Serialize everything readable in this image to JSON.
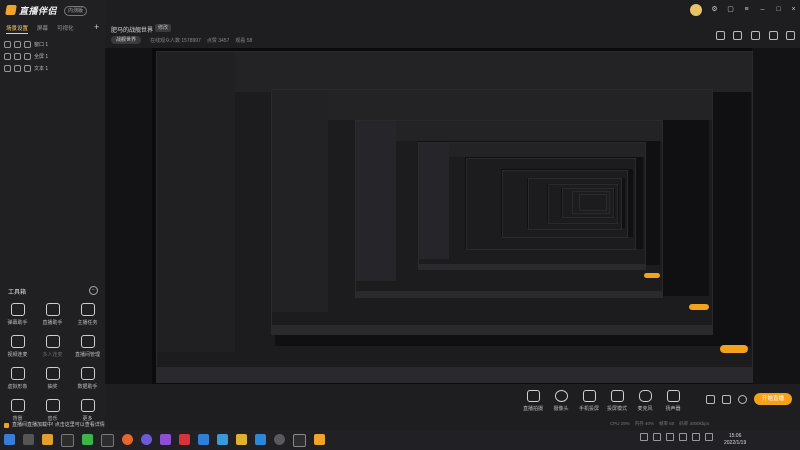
{
  "app": {
    "name": "直播伴侣",
    "version_badge": "内测版",
    "accent": "#f5a11a"
  },
  "scene_tabs": [
    {
      "label": "场景设置",
      "active": true
    },
    {
      "label": "屏幕"
    },
    {
      "label": "可视化"
    }
  ],
  "sources": [
    {
      "label": "窗口 1"
    },
    {
      "label": "全屏 1"
    },
    {
      "label": "文本 1"
    }
  ],
  "tools": {
    "title": "工具箱",
    "items": [
      {
        "label": "弹幕助手",
        "icon": "chat-icon"
      },
      {
        "label": "直播助手",
        "icon": "assistant-icon"
      },
      {
        "label": "主播任务",
        "icon": "task-icon"
      },
      {
        "label": "视频连麦",
        "icon": "link-mic-icon"
      },
      {
        "label": "多人连麦",
        "icon": "multi-link-icon",
        "dim": true
      },
      {
        "label": "直播间管理",
        "icon": "manage-icon"
      },
      {
        "label": "虚拟形象",
        "icon": "avatar-icon"
      },
      {
        "label": "抽奖",
        "icon": "lottery-icon"
      },
      {
        "label": "数据助手",
        "icon": "data-icon"
      },
      {
        "label": "背景",
        "icon": "background-icon"
      },
      {
        "label": "音乐",
        "icon": "music-icon"
      },
      {
        "label": "更多",
        "icon": "more-icon"
      }
    ]
  },
  "header": {
    "stream_title": "肥马的战舰世界",
    "title_tag": "修改",
    "category": "战舰世界",
    "meta": [
      "在线观众人数 1578997",
      "点赞 3457",
      "观看 58"
    ]
  },
  "controls": [
    {
      "label": "直播拍摄",
      "icon": "camera-icon"
    },
    {
      "label": "摄像头",
      "icon": "webcam-icon"
    },
    {
      "label": "手机投屏",
      "icon": "phone-cast-icon"
    },
    {
      "label": "投屏模式",
      "icon": "screen-cast-icon"
    },
    {
      "label": "麦克风",
      "icon": "microphone-icon"
    },
    {
      "label": "扬声器",
      "icon": "speaker-icon"
    }
  ],
  "start_live": "开始直播",
  "status": [
    "CPU 29%",
    "内存 40%",
    "帧率 60",
    "码率 4000kbps"
  ],
  "notice": "直播间直播加载中! 点击这里可以查看详情",
  "clock": {
    "time": "15:06",
    "date": "2022/1/19"
  }
}
